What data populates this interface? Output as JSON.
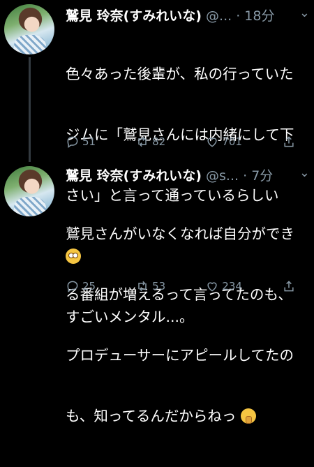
{
  "tweets": [
    {
      "name": "鷲見 玲奈(すみれいな)",
      "handle": "@...",
      "time": "· 18分",
      "lines": [
        "色々あった後輩が、私の行っていた",
        "ジムに「鷲見さんには内緒にして下",
        "さい」と言って通っているらしい"
      ],
      "emoji_line_icon": "flushed-face-emoji",
      "last_line": "すごいメンタル...。",
      "replies": "51",
      "retweets": "82",
      "likes": "701"
    },
    {
      "name": "鷲見 玲奈(すみれいな)",
      "handle": "@s...",
      "time": "· 7分",
      "lines": [
        "鷲見さんがいなくなれば自分ができ",
        "る番組が増えるって言ってたのも、",
        "プロデューサーにアピールしてたの"
      ],
      "last_line": "も、知ってるんだからねっ",
      "trailing_emoji": "shushing-face-emoji",
      "replies": "25",
      "retweets": "53",
      "likes": "234"
    }
  ],
  "colors": {
    "background": "#000000",
    "text": "#ffffff",
    "muted": "#8899a6",
    "thread_line": "#333a40"
  }
}
